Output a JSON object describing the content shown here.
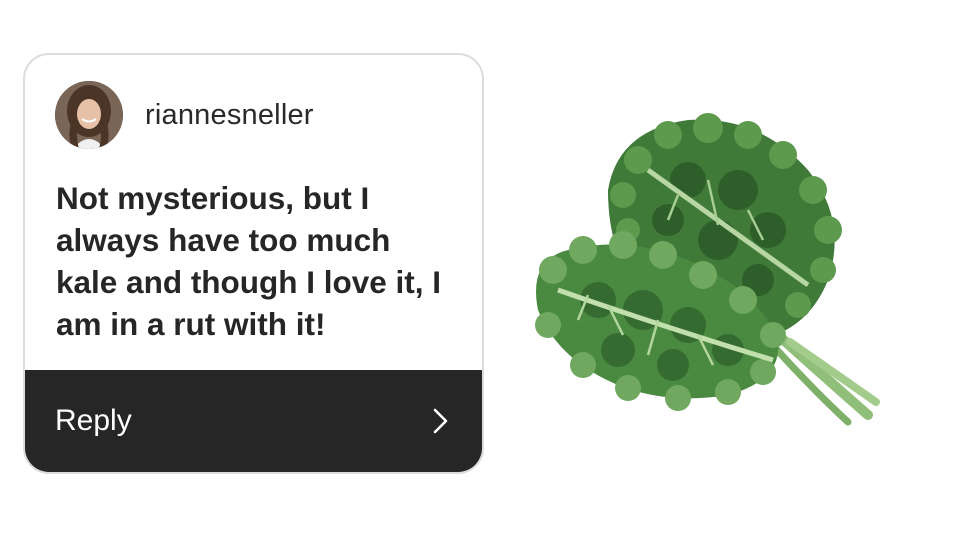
{
  "comment": {
    "username": "riannesneller",
    "avatar_icon": "profile-photo-avatar",
    "message": "Not mysterious, but I always have too much kale and though I love it, I am in a rut with it!"
  },
  "reply": {
    "label": "Reply",
    "icon": "chevron-right-icon"
  },
  "image": {
    "icon": "kale-image"
  },
  "colors": {
    "reply_bar": "#262626",
    "card_border": "#dcdcdc",
    "text": "#262626",
    "kale_dark": "#2f5e2c",
    "kale_light": "#6fa35a"
  }
}
